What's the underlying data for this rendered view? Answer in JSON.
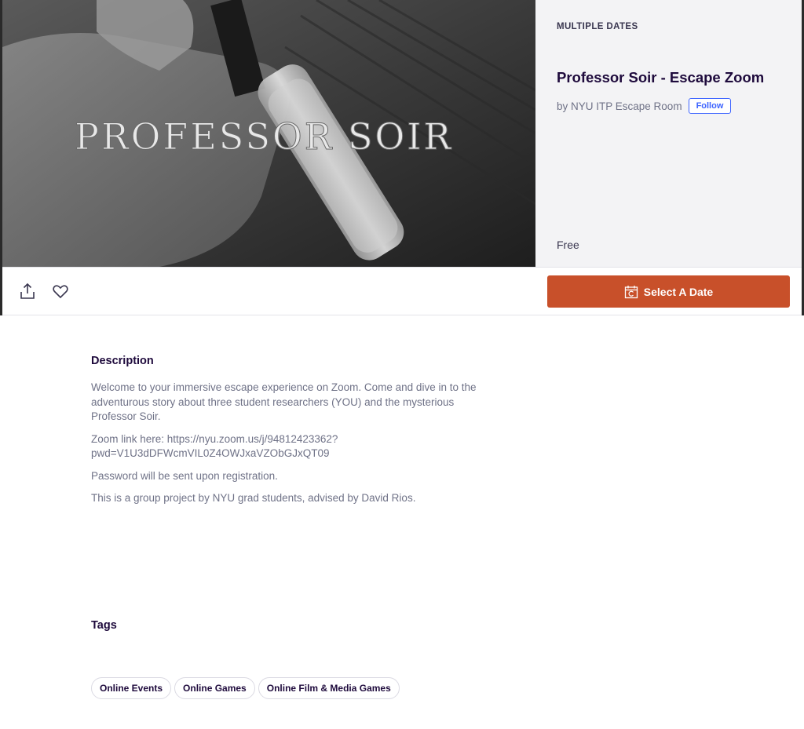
{
  "event": {
    "hero_text": "PROFESSOR SOIR",
    "dates_label": "MULTIPLE DATES",
    "title": "Professor Soir - Escape Zoom",
    "organizer": "by NYU ITP Escape Room",
    "follow_label": "Follow",
    "price": "Free"
  },
  "actions": {
    "share_icon": "share-icon",
    "like_icon": "heart-icon",
    "select_date_label": "Select A Date"
  },
  "description": {
    "heading": "Description",
    "paragraphs": [
      "Welcome to your immersive escape experience on Zoom. Come and dive in to the adventurous story about three student researchers (YOU) and the mysterious Professor Soir.",
      "Zoom link here: https://nyu.zoom.us/j/94812423362?pwd=V1U3dDFWcmVIL0Z4OWJxaVZObGJxQT09",
      "Password will be sent upon registration.",
      "This is a group project by NYU grad students, advised by David Rios."
    ]
  },
  "tags": {
    "heading": "Tags",
    "items": [
      "Online Events",
      "Online Games",
      "Online Film & Media Games"
    ]
  },
  "colors": {
    "accent": "#c8502a",
    "link": "#3d64ff",
    "title": "#1e0a3c"
  }
}
